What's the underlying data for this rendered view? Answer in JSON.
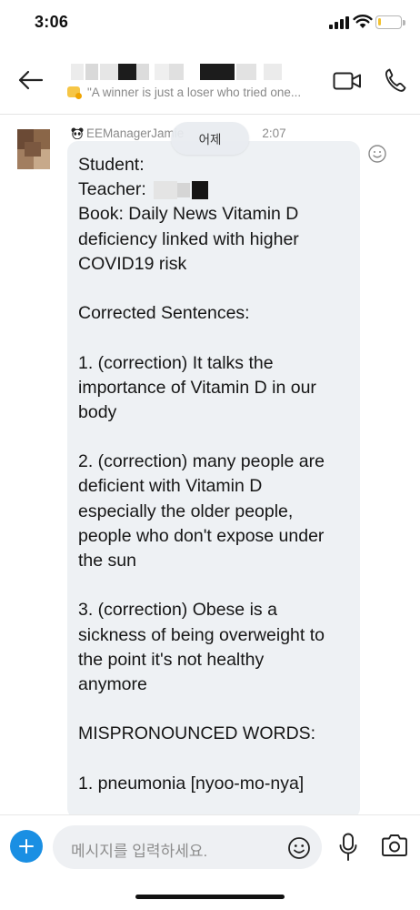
{
  "status_bar": {
    "time": "3:06",
    "battery_percent": 15
  },
  "header": {
    "subtitle": "\"A winner is just a loser who tried one...",
    "icons": {
      "back": "arrow-left-icon",
      "video": "video-camera-icon",
      "call": "phone-icon"
    }
  },
  "message": {
    "sender": "EEManagerJamie",
    "time_suffix": "2:07",
    "date_pill": "어제",
    "lines": [
      "Student:",
      "Teacher:",
      "Book: Daily News Vitamin D",
      "deficiency linked with higher",
      "COVID19 risk",
      "",
      "Corrected Sentences:",
      "",
      "1. (correction) It talks the",
      "importance of Vitamin D in our",
      "body",
      "",
      "2. (correction) many people are",
      "deficient with Vitamin D",
      "especially the older people,",
      "people who don't expose under",
      "the sun",
      "",
      "3. (correction) Obese is a",
      "sickness of being overweight to",
      "the point it's not healthy",
      "anymore",
      "",
      "MISPRONOUNCED WORDS:",
      "",
      "1. pneumonia [nyoo-mo-nya]"
    ]
  },
  "composer": {
    "placeholder": "메시지를 입력하세요.",
    "icons": {
      "add": "plus-icon",
      "emoji": "smiley-icon",
      "mic": "microphone-icon",
      "camera": "camera-icon"
    }
  },
  "colors": {
    "accent": "#1a8fe3",
    "bubble": "#eef1f4",
    "input_bg": "#eef0f3"
  }
}
